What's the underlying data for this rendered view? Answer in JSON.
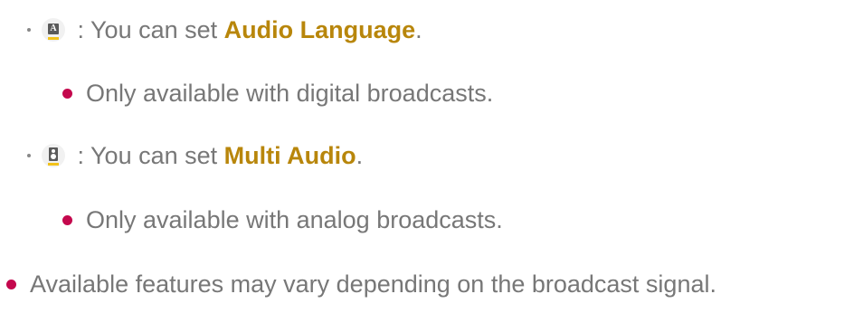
{
  "items": [
    {
      "icon": "audio-language-icon",
      "prefix": " : You can set ",
      "highlight": "Audio Language",
      "suffix": "."
    },
    {
      "note": "Only available with digital broadcasts."
    },
    {
      "icon": "multi-audio-icon",
      "prefix": " : You can set ",
      "highlight": "Multi Audio",
      "suffix": "."
    },
    {
      "note": "Only available with analog broadcasts."
    },
    {
      "note": "Available features may vary depending on the broadcast signal."
    }
  ],
  "colors": {
    "text": "#777777",
    "accent": "#b8860b",
    "bullet": "#c4084d",
    "icon_underline": "#f2c21a"
  }
}
